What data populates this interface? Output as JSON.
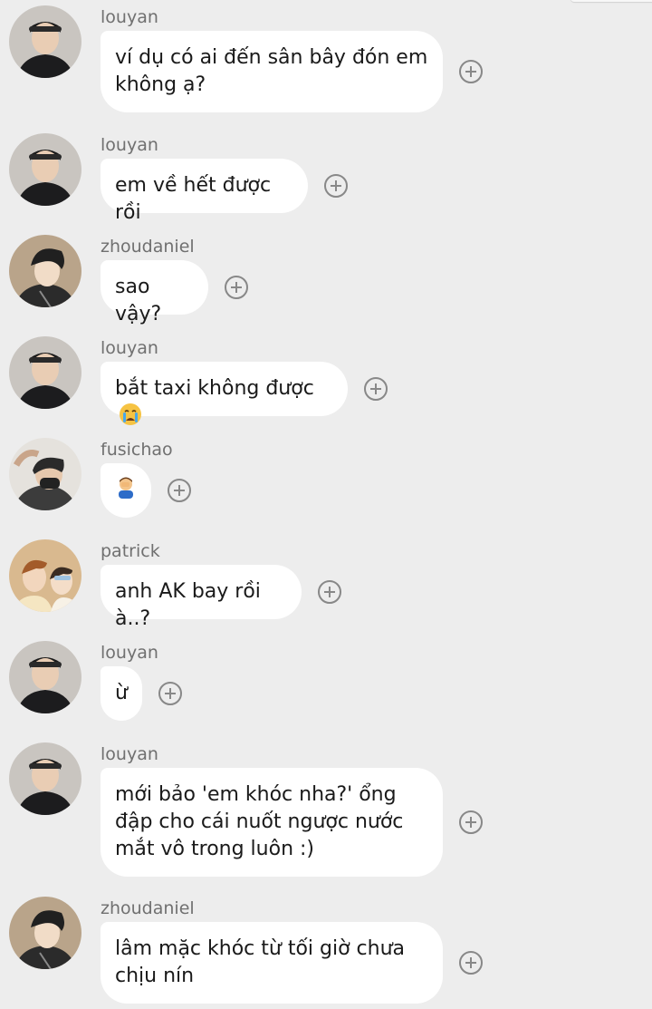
{
  "messages": [
    {
      "username": "louyan",
      "text": "ví dụ có ai đến sân bây đón em không ạ?",
      "avatar": "louyan-avatar"
    },
    {
      "username": "louyan",
      "text": "em về hết được rồi",
      "avatar": "louyan-avatar"
    },
    {
      "username": "zhoudaniel",
      "text": "sao vậy?",
      "avatar": "zhoudaniel-avatar"
    },
    {
      "username": "louyan",
      "text": "bắt taxi không được",
      "emoji": "crying-face-icon",
      "avatar": "louyan-avatar"
    },
    {
      "username": "fusichao",
      "text": "",
      "emoji": "person-facepalming-icon",
      "avatar": "fusichao-avatar"
    },
    {
      "username": "patrick",
      "text": "anh AK bay rồi à..?",
      "avatar": "patrick-avatar"
    },
    {
      "username": "louyan",
      "text": "ừ",
      "avatar": "louyan-avatar"
    },
    {
      "username": "louyan",
      "text": "mới bảo 'em khóc nha?' ổng đập cho cái nuốt ngược nước mắt vô trong luôn :)",
      "avatar": "louyan-avatar"
    },
    {
      "username": "zhoudaniel",
      "text": "lâm mặc khóc từ tối giờ chưa chịu nín",
      "avatar": "zhoudaniel-avatar"
    }
  ],
  "icons": {
    "add": "add-circle-icon"
  },
  "colors": {
    "background": "#ededed",
    "bubble": "#ffffff",
    "username": "#707070",
    "text": "#1a1a1a"
  }
}
